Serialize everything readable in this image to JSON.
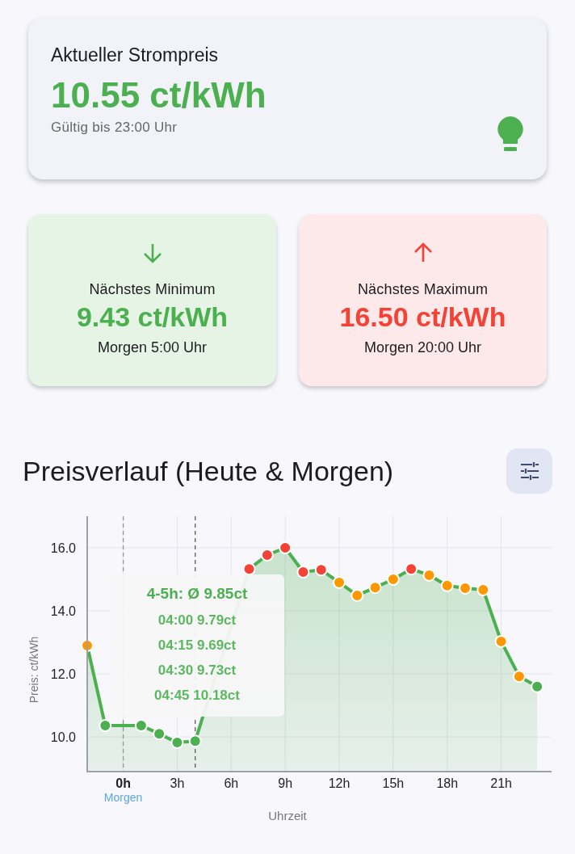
{
  "current": {
    "title": "Aktueller Strompreis",
    "price": "10.55 ct/kWh",
    "valid_until": "Gültig bis 23:00 Uhr"
  },
  "extremes": [
    {
      "kind": "min",
      "label": "Nächstes Minimum",
      "price": "9.43 ct/kWh",
      "time": "Morgen 5:00 Uhr"
    },
    {
      "kind": "max",
      "label": "Nächstes Maximum",
      "price": "16.50 ct/kWh",
      "time": "Morgen 20:00 Uhr"
    }
  ],
  "chart_section": {
    "title": "Preisverlauf (Heute & Morgen)",
    "tooltip": {
      "title": "4-5h: Ø 9.85ct",
      "lines": [
        "04:00 9.79ct",
        "04:15 9.69ct",
        "04:30 9.73ct",
        "04:45 10.18ct"
      ]
    },
    "points": [
      {
        "color": "#ff9800"
      },
      {
        "color": "#4caf50"
      },
      {
        "color": "#4caf50"
      },
      {
        "color": "#4caf50"
      },
      {
        "color": "#4caf50"
      },
      {
        "color": "#4caf50"
      },
      {
        "color": "#f44336"
      },
      {
        "color": "#f44336"
      },
      {
        "color": "#f44336"
      },
      {
        "color": "#f44336"
      },
      {
        "color": "#f44336"
      },
      {
        "color": "#ff9800"
      },
      {
        "color": "#ff9800"
      },
      {
        "color": "#ff9800"
      },
      {
        "color": "#ff9800"
      },
      {
        "color": "#f44336"
      },
      {
        "color": "#ff9800"
      },
      {
        "color": "#ff9800"
      },
      {
        "color": "#ff9800"
      },
      {
        "color": "#ff9800"
      },
      {
        "color": "#ff9800"
      },
      {
        "color": "#ff9800"
      },
      {
        "color": "#4caf50"
      }
    ],
    "chart_data": {
      "type": "area",
      "xlabel": "Uhrzeit",
      "ylabel": "Preis: ct/kWh",
      "grid": true,
      "x": [
        -2,
        -1,
        1,
        2,
        3,
        4,
        7,
        8,
        9,
        10,
        11,
        12,
        13,
        14,
        15,
        16,
        17,
        18,
        19,
        20,
        21,
        22,
        23
      ],
      "series": [
        {
          "color": "#4caf50",
          "values": [
            12.9,
            10.36,
            10.36,
            10.1,
            9.82,
            9.87,
            15.33,
            15.77,
            16.0,
            15.23,
            15.3,
            14.9,
            14.49,
            14.74,
            15.0,
            15.33,
            15.13,
            14.8,
            14.72,
            14.67,
            13.03,
            11.92,
            11.6
          ]
        }
      ],
      "xlim": [
        -2,
        23.8
      ],
      "ylim": [
        8.9,
        17
      ],
      "xticks": [
        {
          "value": 0,
          "label": "0h"
        },
        {
          "value": 3,
          "label": "3h"
        },
        {
          "value": 6,
          "label": "6h"
        },
        {
          "value": 9,
          "label": "9h"
        },
        {
          "value": 12,
          "label": "12h"
        },
        {
          "value": 15,
          "label": "15h"
        },
        {
          "value": 18,
          "label": "18h"
        },
        {
          "value": 21,
          "label": "21h"
        }
      ],
      "yticks": [
        {
          "value": 10,
          "label": "10.0"
        },
        {
          "value": 12,
          "label": "12.0"
        },
        {
          "value": 14,
          "label": "14.0"
        },
        {
          "value": 16,
          "label": "16.0"
        }
      ],
      "ref_lines": [
        {
          "axis": "x",
          "value": 0,
          "label": "Morgen",
          "color": "#999999"
        },
        {
          "axis": "x",
          "value": 4,
          "color": "#666666"
        }
      ]
    }
  }
}
